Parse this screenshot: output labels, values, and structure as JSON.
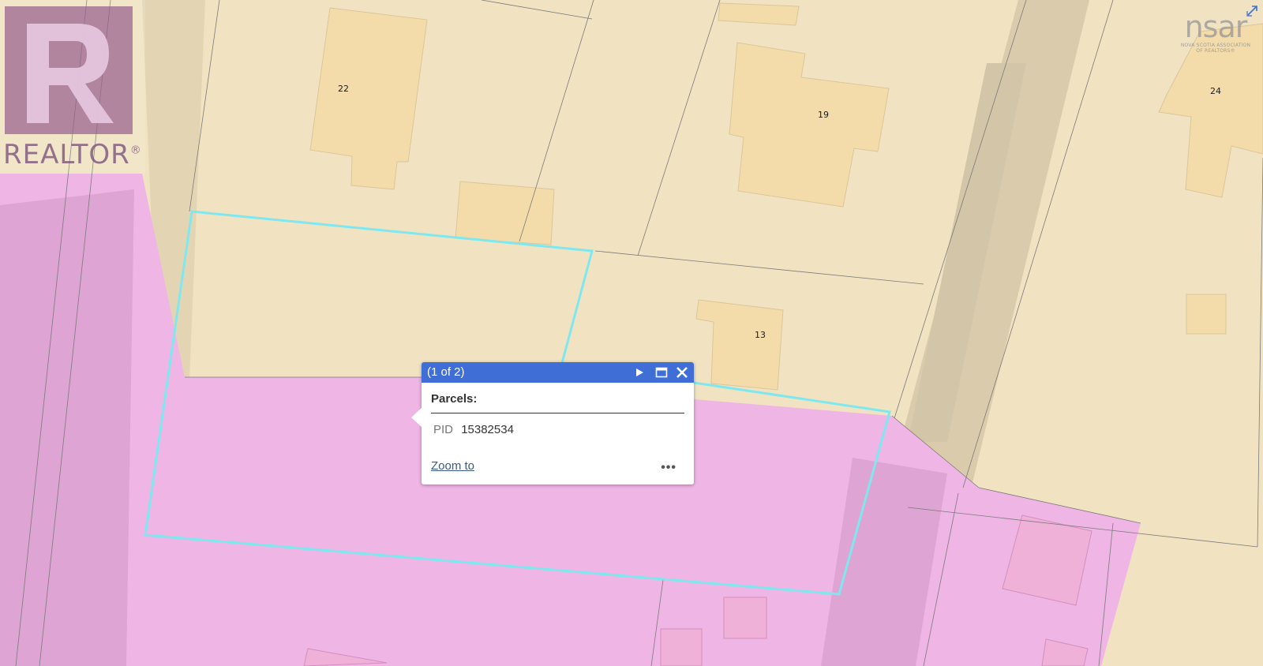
{
  "map": {
    "lot_labels": [
      "22",
      "19",
      "24",
      "13"
    ],
    "colors": {
      "residential": "#f1e3c2",
      "building": "#f4dcaa",
      "pink_zone": "#efb5e5",
      "pink_building": "#efb1d8",
      "selection": "#7fe8ee",
      "parcel_line": "#7a7a7a"
    }
  },
  "logos": {
    "realtor_word": "REALTOR",
    "realtor_reg": "®",
    "nsar_letters": "nsar",
    "nsar_tagline_1": "NOVA SCOTIA ASSOCIATION",
    "nsar_tagline_2": "OF REALTORS®"
  },
  "icons": {
    "expand": "expand-arrow-icon",
    "next": "play-next-icon",
    "maximize": "maximize-window-icon",
    "close": "close-icon",
    "more": "ellipsis-icon"
  },
  "popup": {
    "count": "(1 of 2)",
    "title": "Parcels:",
    "attributes": [
      {
        "name": "PID",
        "value": "15382534"
      }
    ],
    "zoom_label": "Zoom to",
    "more_label": "•••",
    "header_color": "#3f6fd6"
  }
}
